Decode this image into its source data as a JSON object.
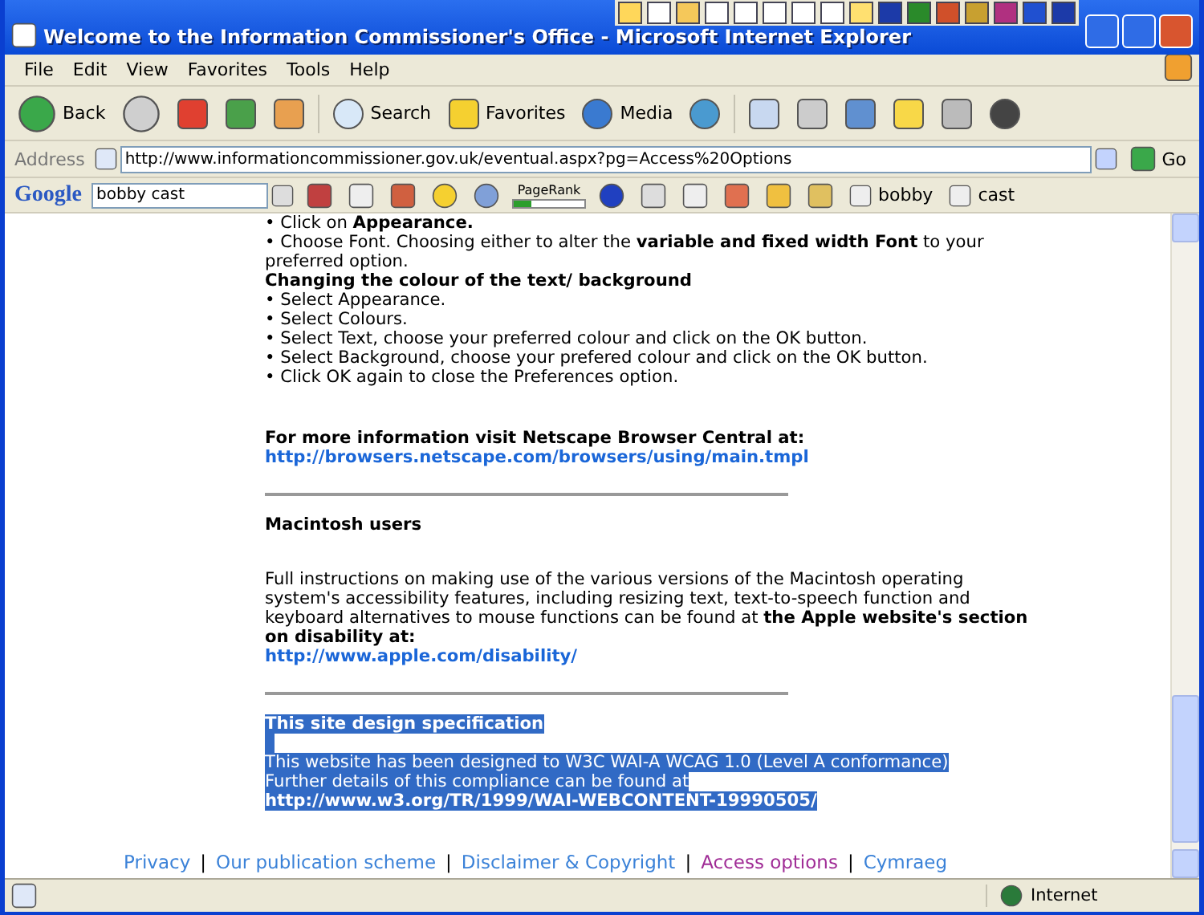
{
  "window": {
    "title": "Welcome to the Information Commissioner's Office - Microsoft Internet Explorer"
  },
  "menu": [
    "File",
    "Edit",
    "View",
    "Favorites",
    "Tools",
    "Help"
  ],
  "toolbar": {
    "back": "Back",
    "search": "Search",
    "favorites": "Favorites",
    "media": "Media"
  },
  "address": {
    "label": "Address",
    "value": "http://www.informationcommissioner.gov.uk/eventual.aspx?pg=Access%20Options",
    "go": "Go"
  },
  "google_bar": {
    "logo": "Google",
    "query": "bobby cast",
    "pagerank_label": "PageRank",
    "pagerank": {
      "level": 0.25
    },
    "buttons": [
      "bobby",
      "cast"
    ]
  },
  "sections": [
    {
      "highlighted": false,
      "blocks": [
        {
          "kind": "line",
          "text": "• Click on **Appearance.**"
        },
        {
          "kind": "line",
          "text": "• Choose Font. Choosing either to alter the **variable and fixed width Font** to your preferred option."
        },
        {
          "kind": "heading",
          "text": "Changing the colour of the text/ background"
        },
        {
          "kind": "line",
          "text": "• Select Appearance."
        },
        {
          "kind": "line",
          "text": "• Select Colours."
        },
        {
          "kind": "line",
          "text": "• Select Text, choose your preferred colour and click on the OK button."
        },
        {
          "kind": "line",
          "text": "• Select Background, choose your prefered colour and click on the OK button."
        },
        {
          "kind": "line",
          "text": "• Click OK again to close the Preferences option."
        }
      ]
    },
    {
      "highlighted": false,
      "blocks": [
        {
          "kind": "heading",
          "text": "For more information visit Netscape Browser Central at:"
        },
        {
          "kind": "link",
          "text": "http://browsers.netscape.com/browsers/using/main.tmpl"
        },
        {
          "kind": "rule"
        }
      ]
    },
    {
      "highlighted": false,
      "blocks": [
        {
          "kind": "heading",
          "text": "Macintosh users"
        }
      ]
    },
    {
      "highlighted": false,
      "blocks": [
        {
          "kind": "line",
          "text": "Full instructions on making use of the various versions of the Macintosh operating system's accessibility features, including resizing text, text-to-speech function and keyboard alternatives to mouse functions can be found at **the Apple website's section on disability at:**"
        },
        {
          "kind": "link",
          "text": "http://www.apple.com/disability/"
        },
        {
          "kind": "rule"
        }
      ]
    },
    {
      "highlighted": true,
      "blocks": [
        {
          "kind": "heading",
          "text": "This site design specification"
        },
        {
          "kind": "blank"
        },
        {
          "kind": "line",
          "text": "This website has been designed to W3C WAI-A WCAG 1.0  (Level A conformance)"
        },
        {
          "kind": "line",
          "text": "Further details of this compliance can be found at"
        },
        {
          "kind": "link",
          "text": "http://www.w3.org/TR/1999/WAI-WEBCONTENT-19990505/"
        }
      ]
    }
  ],
  "footer": [
    {
      "kind": "link",
      "text": "Privacy",
      "visited": false
    },
    {
      "kind": "separator",
      "text": "|"
    },
    {
      "kind": "link",
      "text": "Our publication scheme",
      "visited": false
    },
    {
      "kind": "separator",
      "text": "|"
    },
    {
      "kind": "link",
      "text": "Disclaimer & Copyright",
      "visited": false
    },
    {
      "kind": "separator",
      "text": "|"
    },
    {
      "kind": "link",
      "text": "Access options",
      "visited": true
    },
    {
      "kind": "separator",
      "text": "|"
    },
    {
      "kind": "link",
      "text": "Cymraeg",
      "visited": false
    }
  ],
  "status_bar": {
    "zone": "Internet"
  }
}
